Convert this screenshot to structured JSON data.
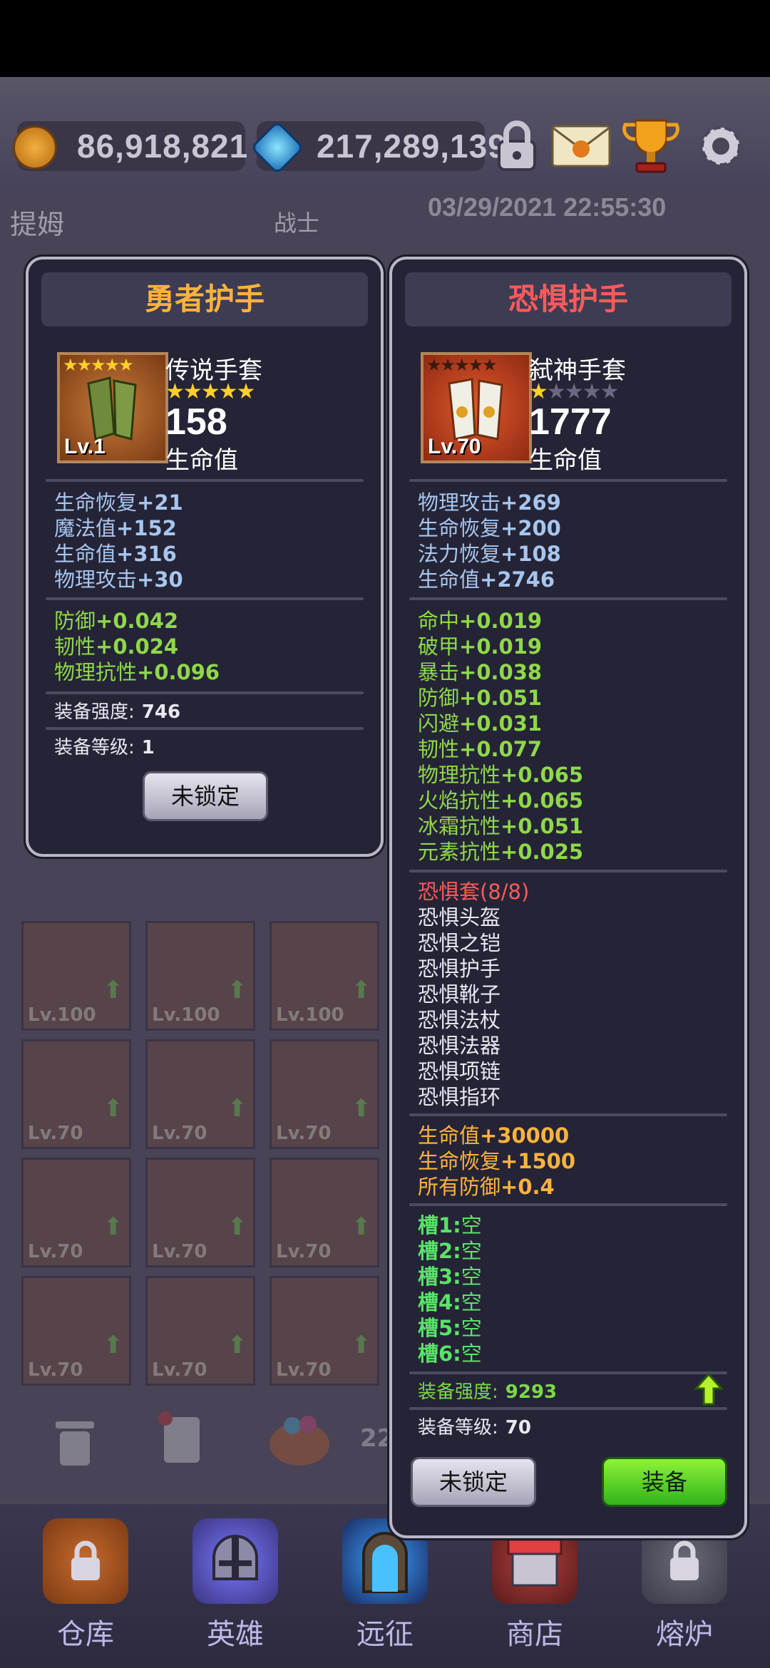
{
  "resources": {
    "gold": "86,918,821",
    "gems": "217,289,139"
  },
  "icons": {
    "lock": "lock-icon",
    "mail": "mail-icon",
    "trophy": "trophy-icon",
    "settings": "gear-icon"
  },
  "hero": {
    "name": "提姆",
    "class": "战士",
    "timestamp": "03/29/2021 22:55:30"
  },
  "inventory_levels": [
    "Lv.100",
    "Lv.100",
    "Lv.100",
    "Lv.70",
    "Lv.70",
    "Lv.70",
    "Lv.70",
    "Lv.70",
    "Lv.70",
    "Lv.70",
    "Lv.70",
    "Lv.70"
  ],
  "inventory_count": "22",
  "nav": [
    {
      "label": "仓库",
      "icon": "bag-icon"
    },
    {
      "label": "英雄",
      "icon": "helmet-icon"
    },
    {
      "label": "远征",
      "icon": "portal-icon"
    },
    {
      "label": "商店",
      "icon": "shop-icon"
    },
    {
      "label": "熔炉",
      "icon": "furnace-icon"
    }
  ],
  "left_card": {
    "title": "勇者护手",
    "item_level": "Lv.1",
    "item_stars": "★★★★★",
    "item_name": "传说手套",
    "quality_stars": "★★★★★",
    "value": "158",
    "value_label": "生命值",
    "base_stats": [
      {
        "name": "生命恢复",
        "val": "+21"
      },
      {
        "name": "魔法值",
        "val": "+152"
      },
      {
        "name": "生命值",
        "val": "+316"
      },
      {
        "name": "物理攻击",
        "val": "+30"
      }
    ],
    "extra_stats": [
      {
        "name": "防御",
        "val": "+0.042"
      },
      {
        "name": "韧性",
        "val": "+0.024"
      },
      {
        "name": "物理抗性",
        "val": "+0.096"
      }
    ],
    "power_label": "装备强度:",
    "power": "746",
    "level_label": "装备等级:",
    "level": "1",
    "lock_button": "未锁定"
  },
  "right_card": {
    "title": "恐惧护手",
    "item_level": "Lv.70",
    "item_stars": "★★★★★",
    "item_name": "弑神手套",
    "quality_stars": "★",
    "quality_empty": "★★★★",
    "value": "1777",
    "value_label": "生命值",
    "base_stats": [
      {
        "name": "物理攻击",
        "val": "+269"
      },
      {
        "name": "生命恢复",
        "val": "+200"
      },
      {
        "name": "法力恢复",
        "val": "+108"
      },
      {
        "name": "生命值",
        "val": "+2746"
      }
    ],
    "extra_stats": [
      {
        "name": "命中",
        "val": "+0.019"
      },
      {
        "name": "破甲",
        "val": "+0.019"
      },
      {
        "name": "暴击",
        "val": "+0.038"
      },
      {
        "name": "防御",
        "val": "+0.051"
      },
      {
        "name": "闪避",
        "val": "+0.031"
      },
      {
        "name": "韧性",
        "val": "+0.077"
      },
      {
        "name": "物理抗性",
        "val": "+0.065"
      },
      {
        "name": "火焰抗性",
        "val": "+0.065"
      },
      {
        "name": "冰霜抗性",
        "val": "+0.051"
      },
      {
        "name": "元素抗性",
        "val": "+0.025"
      }
    ],
    "set_title": "恐惧套(8/8)",
    "set_items": [
      "恐惧头盔",
      "恐惧之铠",
      "恐惧护手",
      "恐惧靴子",
      "恐惧法杖",
      "恐惧法器",
      "恐惧项链",
      "恐惧指环"
    ],
    "set_bonus": [
      {
        "name": "生命值",
        "val": "+30000"
      },
      {
        "name": "生命恢复",
        "val": "+1500"
      },
      {
        "name": "所有防御",
        "val": "+0.4"
      }
    ],
    "slots": [
      {
        "name": "槽1:",
        "val": "空"
      },
      {
        "name": "槽2:",
        "val": "空"
      },
      {
        "name": "槽3:",
        "val": "空"
      },
      {
        "name": "槽4:",
        "val": "空"
      },
      {
        "name": "槽5:",
        "val": "空"
      },
      {
        "name": "槽6:",
        "val": "空"
      }
    ],
    "power_label": "装备强度:",
    "power": "9293",
    "level_label": "装备等级:",
    "level": "70",
    "lock_button": "未锁定",
    "equip_button": "装备"
  }
}
